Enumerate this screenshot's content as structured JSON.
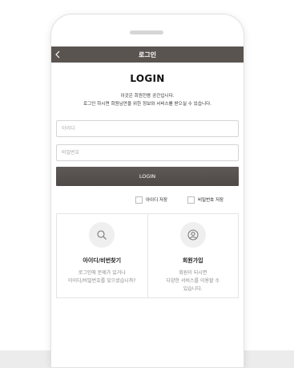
{
  "header": {
    "title": "로그인"
  },
  "login": {
    "heading": "LOGIN",
    "desc_line1": "이곳은 회원전용 공간입니다.",
    "desc_line2": "로그인 하시면 회원님만을 위한 정보와 서비스를 받으실 수 있습니다.",
    "id_placeholder": "아이디",
    "password_placeholder": "비밀번호",
    "button_label": "LOGIN",
    "save_id_label": "아이디 저장",
    "save_password_label": "비밀번호 저장"
  },
  "find": {
    "title": "아이디/비번찾기",
    "line1": "로그인에 문제가 있거나",
    "line2": "아이디/비밀번호를 잊으셨습니까?"
  },
  "join": {
    "title": "회원가입",
    "line1": "회원이 되시면",
    "line2": "다양한 서비스를 이용할 수",
    "line3": "있습니다."
  },
  "colors": {
    "titlebar_bg": "#5a5451",
    "button_bg": "#565150"
  },
  "icons": {
    "back": "chevron-left-icon",
    "find": "search-icon",
    "join": "user-circle-icon"
  }
}
